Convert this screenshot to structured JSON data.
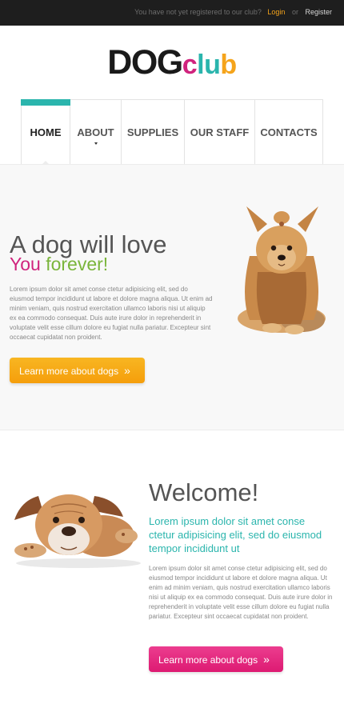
{
  "topbar": {
    "message": "You have not yet registered to our club?",
    "login": "Login",
    "or": "or",
    "register": "Register"
  },
  "logo": {
    "dog": "DOG",
    "club_letters": [
      "c",
      "l",
      "u",
      "b"
    ],
    "club_colors": [
      "#d0237d",
      "#2bb5ad",
      "#2bb5ad",
      "#f5a41b"
    ]
  },
  "nav": {
    "items": [
      "HOME",
      "ABOUT",
      "SUPPLIES",
      "OUR STAFF",
      "CONTACTS"
    ],
    "active": "HOME",
    "accent": "#2bb5ad"
  },
  "hero": {
    "title_line1": "A dog will love",
    "title_you": "You",
    "title_forever": "forever!",
    "paragraph": "Lorem ipsum dolor sit amet conse ctetur adipisicing elit, sed do eiusmod tempor incididunt ut labore et dolore magna aliqua. Ut enim ad minim veniam, quis nostrud exercitation ullamco laboris nisi ut aliquip ex ea commodo consequat. Duis aute irure dolor in reprehenderit in voluptate velit esse cillum dolore eu fugiat nulla pariatur. Excepteur sint occaecat cupidatat non proident.",
    "button": "Learn more about dogs",
    "button_color": "#f5a41b"
  },
  "welcome": {
    "title": "Welcome!",
    "subtitle": "Lorem ipsum dolor sit amet conse ctetur adipisicing elit, sed do eiusmod tempor incididunt ut",
    "paragraph": "Lorem ipsum dolor sit amet conse ctetur adipisicing elit, sed do eiusmod tempor incididunt ut labore et dolore magna aliqua. Ut enim ad minim veniam, quis nostrud exercitation ullamco laboris nisi ut aliquip ex ea commodo consequat. Duis aute irure dolor in reprehenderit in voluptate velit esse cillum dolore eu fugiat nulla pariatur. Excepteur sint occaecat cupidatat non proident.",
    "button": "Learn more about dogs",
    "button_color": "#dd1a72"
  },
  "icons": {
    "button_arrow": "double-chevron-right-icon",
    "nav_caret": "caret-down-icon"
  }
}
